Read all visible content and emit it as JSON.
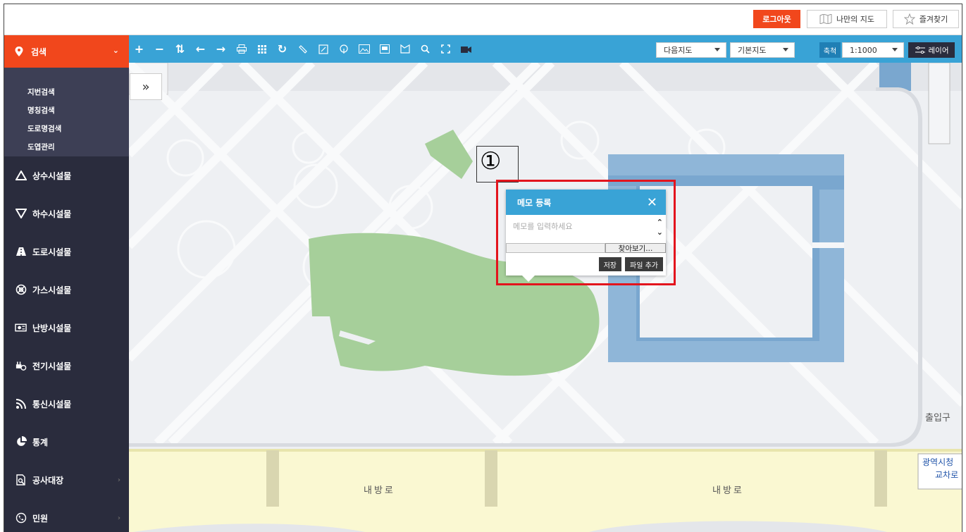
{
  "header": {
    "logout_label": "로그아웃",
    "mymap_label": "나만의 지도",
    "favorites_label": "즐겨찾기"
  },
  "sidebar": {
    "search_label": "검색",
    "submenu": [
      "지번검색",
      "명칭검색",
      "도로명검색",
      "도엽관리"
    ],
    "items": [
      {
        "label": "상수시설물",
        "icon": "triangle-up-icon",
        "arrow": false
      },
      {
        "label": "하수시설물",
        "icon": "triangle-down-icon",
        "arrow": false
      },
      {
        "label": "도로시설물",
        "icon": "road-icon",
        "arrow": false
      },
      {
        "label": "가스시설물",
        "icon": "gas-icon",
        "arrow": false
      },
      {
        "label": "난방시설물",
        "icon": "heating-icon",
        "arrow": false
      },
      {
        "label": "전기시설물",
        "icon": "electric-icon",
        "arrow": false
      },
      {
        "label": "통신시설물",
        "icon": "wifi-icon",
        "arrow": false
      },
      {
        "label": "통계",
        "icon": "pie-chart-icon",
        "arrow": false
      },
      {
        "label": "공사대장",
        "icon": "document-search-icon",
        "arrow": true
      },
      {
        "label": "민원",
        "icon": "phone-icon",
        "arrow": true
      }
    ]
  },
  "toolbar": {
    "icons": [
      "zoom-in-icon",
      "zoom-out-icon",
      "swap-icon",
      "back-icon",
      "forward-icon",
      "print-icon",
      "grid-icon",
      "refresh-icon",
      "measure-distance-icon",
      "measure-area-icon",
      "measure-radius-icon",
      "image-icon",
      "memo-icon",
      "polygon-icon",
      "search-icon",
      "fullscreen-icon",
      "video-icon"
    ],
    "map_source": "다음지도",
    "map_type": "기본지도",
    "scale_label": "축척",
    "scale_value": "1:1000",
    "layer_label": "레이어"
  },
  "annotation": {
    "number": "①"
  },
  "memo": {
    "title": "메모 등록",
    "placeholder": "메모를 입력하세요",
    "browse_label": "찾아보기...",
    "save_label": "저장",
    "add_file_label": "파일 추가"
  },
  "map": {
    "labels": [
      "출입구",
      "내방로",
      "내방로",
      "광역시청",
      "교차로"
    ]
  },
  "colors": {
    "accent": "#f1471c",
    "toolbar": "#39a3d6",
    "sidebar": "#2a2c3d",
    "highlight": "#e3141d"
  }
}
